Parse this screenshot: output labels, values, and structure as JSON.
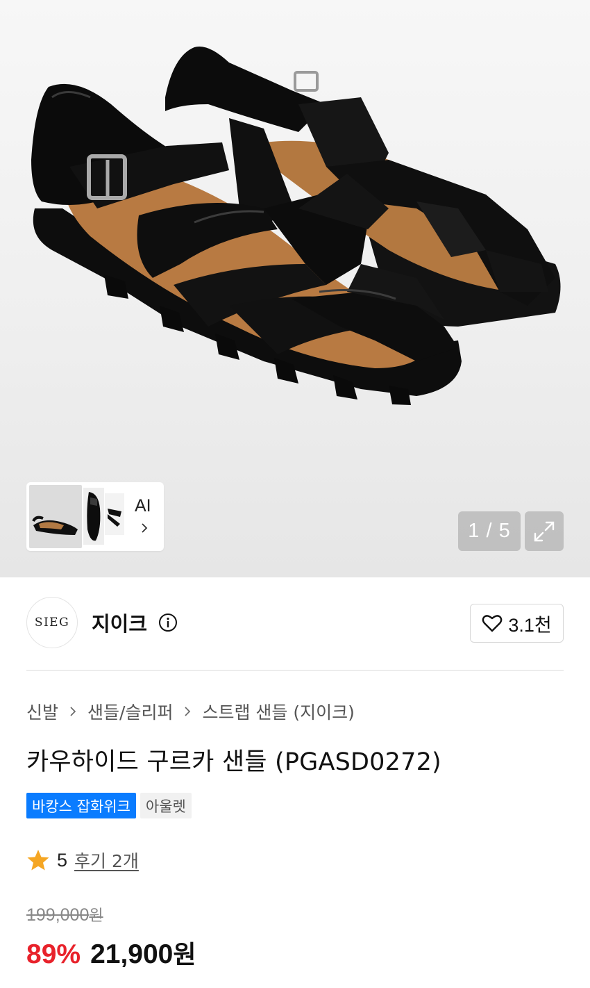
{
  "gallery": {
    "thumbnail_ai_label": "AI",
    "counter": "1 / 5"
  },
  "brand": {
    "logo_text": "SIEG",
    "name": "지이크",
    "likes": "3.1천"
  },
  "breadcrumb": [
    "신발",
    "샌들/슬리퍼",
    "스트랩 샌들 (지이크)"
  ],
  "product": {
    "title": "카우하이드 구르카 샌들 (PGASD0272)",
    "badges": {
      "promo": "바캉스 잡화위크",
      "outlet": "아울렛"
    },
    "rating": {
      "score": "5",
      "reviews": "후기 2개"
    },
    "price": {
      "original": "199,000",
      "discount": "89%",
      "sale": "21,900",
      "currency": "원"
    }
  },
  "colors": {
    "accent_blue": "#0a7cff",
    "discount_red": "#e8222b",
    "star": "#f5a623"
  },
  "icons": [
    "info-icon",
    "heart-icon",
    "chevron-right-icon",
    "expand-icon",
    "star-icon"
  ]
}
